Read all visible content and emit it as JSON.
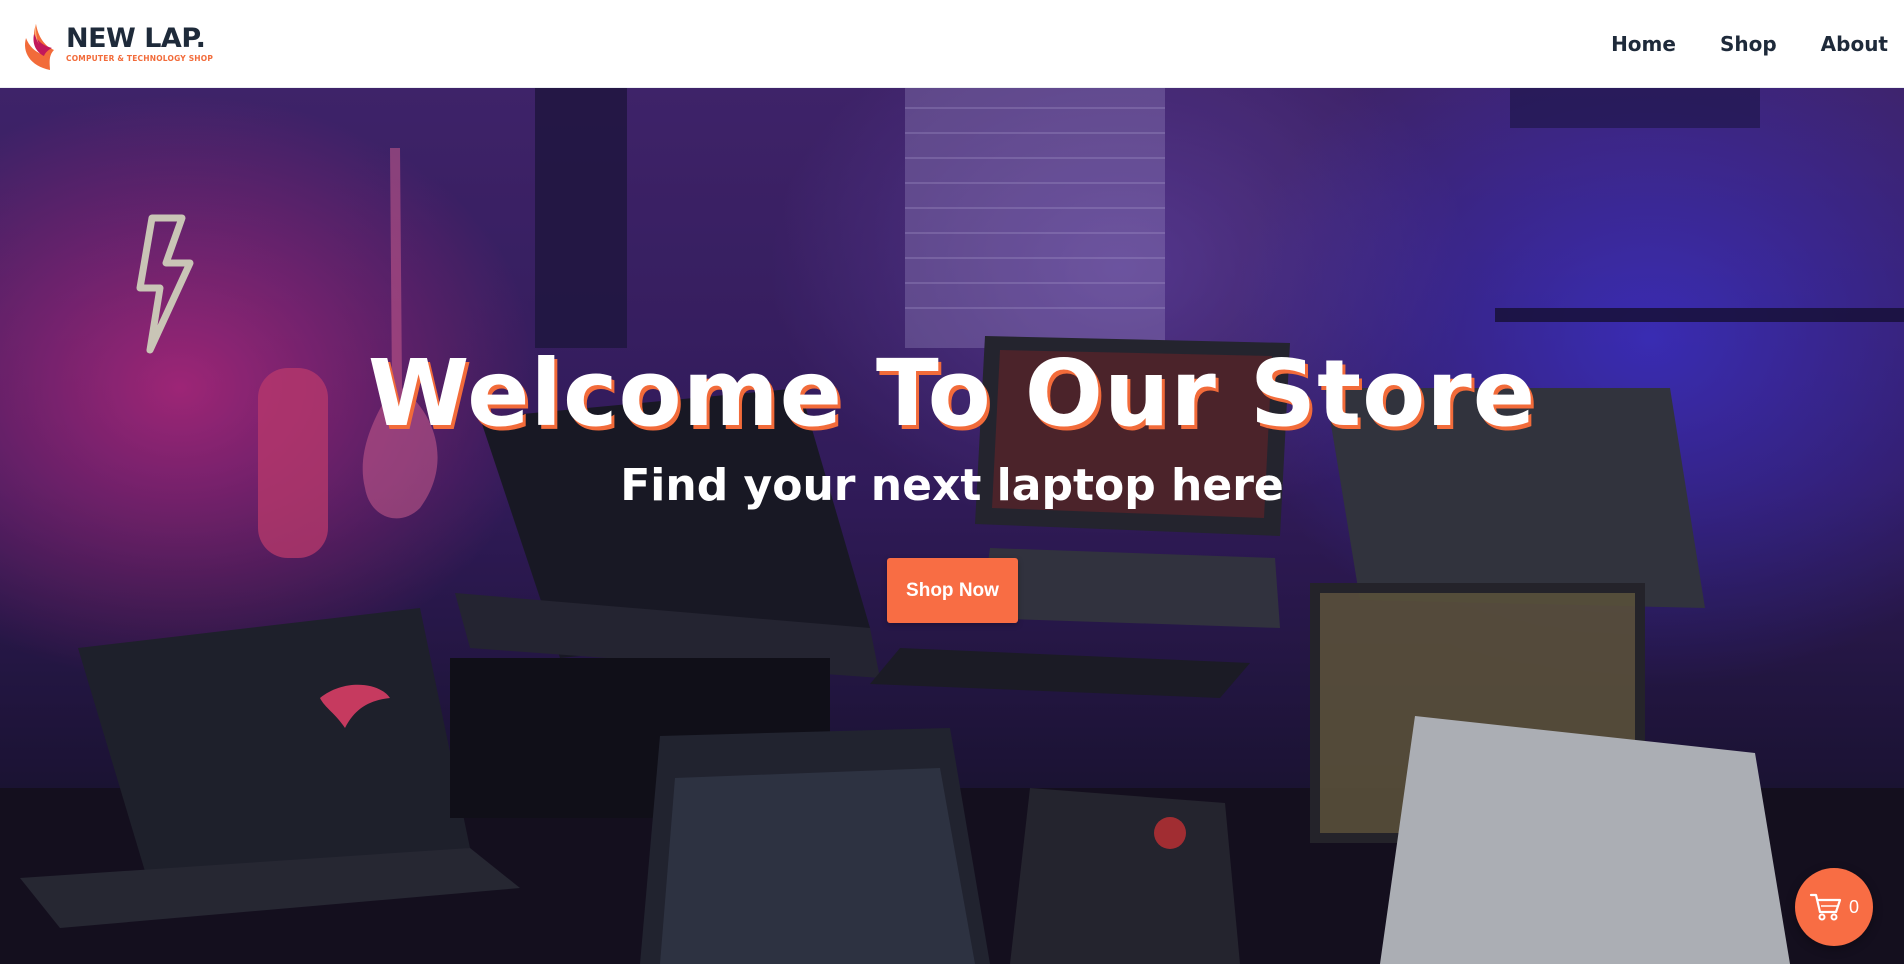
{
  "brand": {
    "name": "NEW LAP.",
    "tagline": "COMPUTER & TECHNOLOGY SHOP",
    "icon": "wing-logo"
  },
  "nav": {
    "links": [
      {
        "label": "Home"
      },
      {
        "label": "Shop"
      },
      {
        "label": "About"
      }
    ]
  },
  "hero": {
    "title": "Welcome To Our Store",
    "subtitle": "Find your next laptop here",
    "cta_label": "Shop Now",
    "background": "gaming laptops on desk in neon-lit room"
  },
  "cart": {
    "icon": "cart-icon",
    "count": "0"
  },
  "colors": {
    "accent": "#f86d44",
    "navy": "#1e2a3a",
    "white": "#ffffff"
  }
}
